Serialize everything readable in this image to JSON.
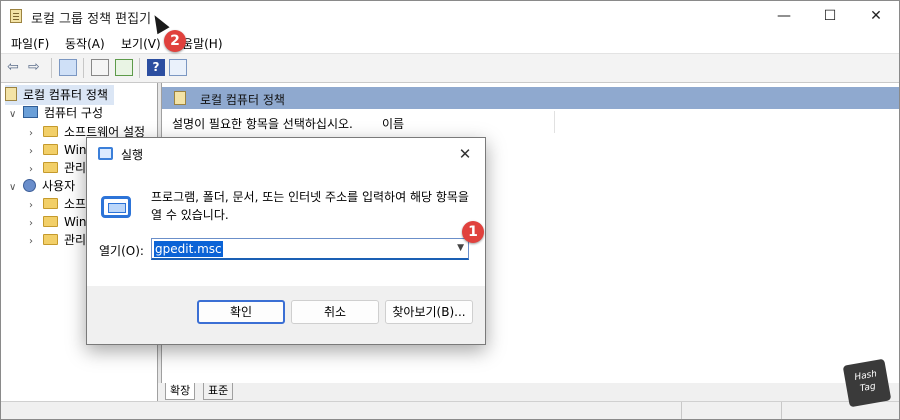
{
  "window": {
    "title": "로컬 그룹 정책 편집기",
    "controls": {
      "minimize": "—",
      "maximize": "☐",
      "close": "✕"
    }
  },
  "menu": [
    {
      "label": "파일(F)"
    },
    {
      "label": "동작(A)"
    },
    {
      "label": "보기(V)"
    },
    {
      "label": "도움말(H)"
    }
  ],
  "tree": {
    "root": "로컬 컴퓨터 정책",
    "computer": "컴퓨터 구성",
    "computer_children": [
      "소프트웨어 설정",
      "Win",
      "관리"
    ],
    "user": "사용자",
    "user_children": [
      "소프",
      "Wind",
      "관리"
    ]
  },
  "right_pane": {
    "header": "로컬 컴퓨터 정책",
    "description": "설명이 필요한 항목을 선택하십시오.",
    "column_name": "이름"
  },
  "tabs": [
    "확장",
    "표준"
  ],
  "run_dialog": {
    "title": "실행",
    "description": "프로그램, 폴더, 문서, 또는 인터넷 주소를 입력하여 해당 항목을 열 수 있습니다.",
    "open_label": "열기(O):",
    "open_value": "gpedit.msc",
    "ok": "확인",
    "cancel": "취소",
    "browse": "찾아보기(B)..."
  },
  "badges": {
    "step1": "1",
    "step2": "2"
  },
  "watermark": {
    "line1": "Hash",
    "line2": "Tag"
  },
  "colors": {
    "badge": "#e0413d",
    "selection": "#0b63d6",
    "header": "#8fa9cf"
  }
}
